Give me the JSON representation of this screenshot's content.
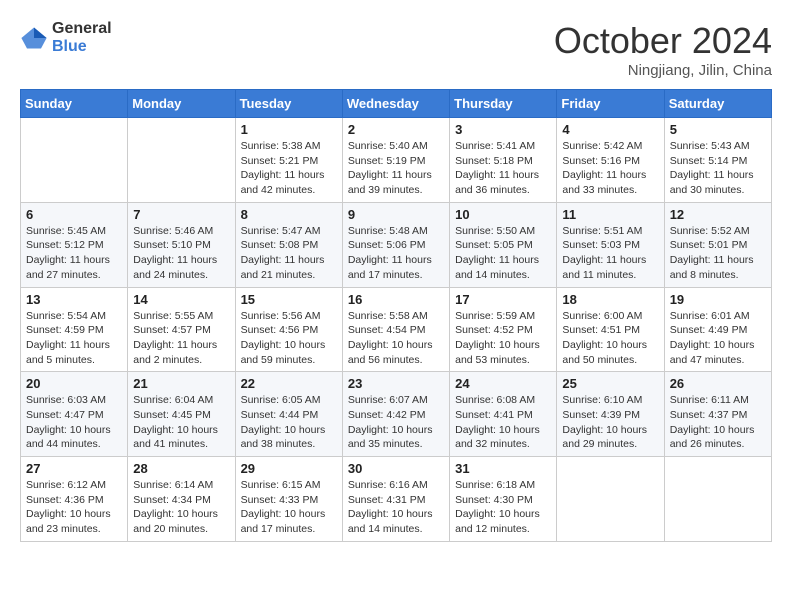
{
  "header": {
    "logo_general": "General",
    "logo_blue": "Blue",
    "month_title": "October 2024",
    "location": "Ningjiang, Jilin, China"
  },
  "weekdays": [
    "Sunday",
    "Monday",
    "Tuesday",
    "Wednesday",
    "Thursday",
    "Friday",
    "Saturday"
  ],
  "weeks": [
    [
      {
        "day": "",
        "info": ""
      },
      {
        "day": "",
        "info": ""
      },
      {
        "day": "1",
        "info": "Sunrise: 5:38 AM\nSunset: 5:21 PM\nDaylight: 11 hours and 42 minutes."
      },
      {
        "day": "2",
        "info": "Sunrise: 5:40 AM\nSunset: 5:19 PM\nDaylight: 11 hours and 39 minutes."
      },
      {
        "day": "3",
        "info": "Sunrise: 5:41 AM\nSunset: 5:18 PM\nDaylight: 11 hours and 36 minutes."
      },
      {
        "day": "4",
        "info": "Sunrise: 5:42 AM\nSunset: 5:16 PM\nDaylight: 11 hours and 33 minutes."
      },
      {
        "day": "5",
        "info": "Sunrise: 5:43 AM\nSunset: 5:14 PM\nDaylight: 11 hours and 30 minutes."
      }
    ],
    [
      {
        "day": "6",
        "info": "Sunrise: 5:45 AM\nSunset: 5:12 PM\nDaylight: 11 hours and 27 minutes."
      },
      {
        "day": "7",
        "info": "Sunrise: 5:46 AM\nSunset: 5:10 PM\nDaylight: 11 hours and 24 minutes."
      },
      {
        "day": "8",
        "info": "Sunrise: 5:47 AM\nSunset: 5:08 PM\nDaylight: 11 hours and 21 minutes."
      },
      {
        "day": "9",
        "info": "Sunrise: 5:48 AM\nSunset: 5:06 PM\nDaylight: 11 hours and 17 minutes."
      },
      {
        "day": "10",
        "info": "Sunrise: 5:50 AM\nSunset: 5:05 PM\nDaylight: 11 hours and 14 minutes."
      },
      {
        "day": "11",
        "info": "Sunrise: 5:51 AM\nSunset: 5:03 PM\nDaylight: 11 hours and 11 minutes."
      },
      {
        "day": "12",
        "info": "Sunrise: 5:52 AM\nSunset: 5:01 PM\nDaylight: 11 hours and 8 minutes."
      }
    ],
    [
      {
        "day": "13",
        "info": "Sunrise: 5:54 AM\nSunset: 4:59 PM\nDaylight: 11 hours and 5 minutes."
      },
      {
        "day": "14",
        "info": "Sunrise: 5:55 AM\nSunset: 4:57 PM\nDaylight: 11 hours and 2 minutes."
      },
      {
        "day": "15",
        "info": "Sunrise: 5:56 AM\nSunset: 4:56 PM\nDaylight: 10 hours and 59 minutes."
      },
      {
        "day": "16",
        "info": "Sunrise: 5:58 AM\nSunset: 4:54 PM\nDaylight: 10 hours and 56 minutes."
      },
      {
        "day": "17",
        "info": "Sunrise: 5:59 AM\nSunset: 4:52 PM\nDaylight: 10 hours and 53 minutes."
      },
      {
        "day": "18",
        "info": "Sunrise: 6:00 AM\nSunset: 4:51 PM\nDaylight: 10 hours and 50 minutes."
      },
      {
        "day": "19",
        "info": "Sunrise: 6:01 AM\nSunset: 4:49 PM\nDaylight: 10 hours and 47 minutes."
      }
    ],
    [
      {
        "day": "20",
        "info": "Sunrise: 6:03 AM\nSunset: 4:47 PM\nDaylight: 10 hours and 44 minutes."
      },
      {
        "day": "21",
        "info": "Sunrise: 6:04 AM\nSunset: 4:45 PM\nDaylight: 10 hours and 41 minutes."
      },
      {
        "day": "22",
        "info": "Sunrise: 6:05 AM\nSunset: 4:44 PM\nDaylight: 10 hours and 38 minutes."
      },
      {
        "day": "23",
        "info": "Sunrise: 6:07 AM\nSunset: 4:42 PM\nDaylight: 10 hours and 35 minutes."
      },
      {
        "day": "24",
        "info": "Sunrise: 6:08 AM\nSunset: 4:41 PM\nDaylight: 10 hours and 32 minutes."
      },
      {
        "day": "25",
        "info": "Sunrise: 6:10 AM\nSunset: 4:39 PM\nDaylight: 10 hours and 29 minutes."
      },
      {
        "day": "26",
        "info": "Sunrise: 6:11 AM\nSunset: 4:37 PM\nDaylight: 10 hours and 26 minutes."
      }
    ],
    [
      {
        "day": "27",
        "info": "Sunrise: 6:12 AM\nSunset: 4:36 PM\nDaylight: 10 hours and 23 minutes."
      },
      {
        "day": "28",
        "info": "Sunrise: 6:14 AM\nSunset: 4:34 PM\nDaylight: 10 hours and 20 minutes."
      },
      {
        "day": "29",
        "info": "Sunrise: 6:15 AM\nSunset: 4:33 PM\nDaylight: 10 hours and 17 minutes."
      },
      {
        "day": "30",
        "info": "Sunrise: 6:16 AM\nSunset: 4:31 PM\nDaylight: 10 hours and 14 minutes."
      },
      {
        "day": "31",
        "info": "Sunrise: 6:18 AM\nSunset: 4:30 PM\nDaylight: 10 hours and 12 minutes."
      },
      {
        "day": "",
        "info": ""
      },
      {
        "day": "",
        "info": ""
      }
    ]
  ]
}
